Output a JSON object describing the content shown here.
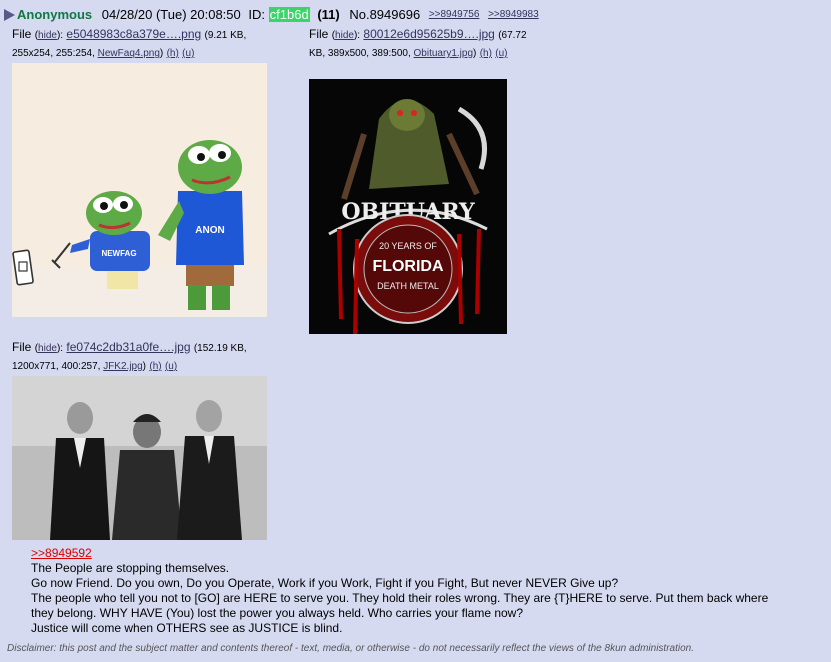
{
  "post": {
    "name": "Anonymous",
    "date": "04/28/20 (Tue) 20:08:50",
    "id_label": "ID:",
    "id_value": "cf1b6d",
    "post_count": "(11)",
    "post_no": "No.8949696",
    "backlinks": [
      ">>8949756",
      ">>8949983"
    ],
    "colors": {
      "name": "#117743",
      "id_bg": "#3bd46a",
      "quote": "#dd0000",
      "link": "#34345c",
      "bg": "#d6daf0"
    }
  },
  "files": [
    {
      "label": "File",
      "hide": "hide",
      "filename": "e5048983c8a379e….png",
      "meta_open": "(9.21 KB, 255x254, 255:254, ",
      "original": "NewFaq4.png",
      "h": "(h)",
      "u": "(u)",
      "thumb_texts": [
        "NEWFAG",
        "ANON"
      ]
    },
    {
      "label": "File",
      "hide": "hide",
      "filename": "80012e6d95625b9….jpg",
      "meta_open": "(67.72 KB, 389x500, 389:500, ",
      "original": "Obituary1.jpg",
      "h": "(h)",
      "u": "(u)",
      "thumb_texts": [
        "OBITUARY",
        "20 YEARS OF",
        "FLORIDA",
        "DEATH METAL"
      ]
    },
    {
      "label": "File",
      "hide": "hide",
      "filename": "fe074c2db31a0fe….jpg",
      "meta_open": "(152.19 KB, 1200x771, 400:257, ",
      "original": "JFK2.jpg",
      "h": "(h)",
      "u": "(u)"
    }
  ],
  "body": {
    "quote": ">>8949592",
    "lines": [
      "The People are stopping themselves.",
      "Go now Friend. Do you own, Do you Operate, Work if you Work, Fight if you Fight, But never NEVER Give up?",
      "The people who tell you not to [GO] are HERE to serve you. They hold their roles wrong. They are {T}HERE to serve. Put them back where they belong. WHY HAVE (You) lost the power you always held. Who carries your flame now?",
      "Justice will come when OTHERS see as JUSTICE is blind."
    ]
  },
  "disclaimer": "Disclaimer: this post and the subject matter and contents thereof - text, media, or otherwise - do not necessarily reflect the views of the 8kun administration."
}
